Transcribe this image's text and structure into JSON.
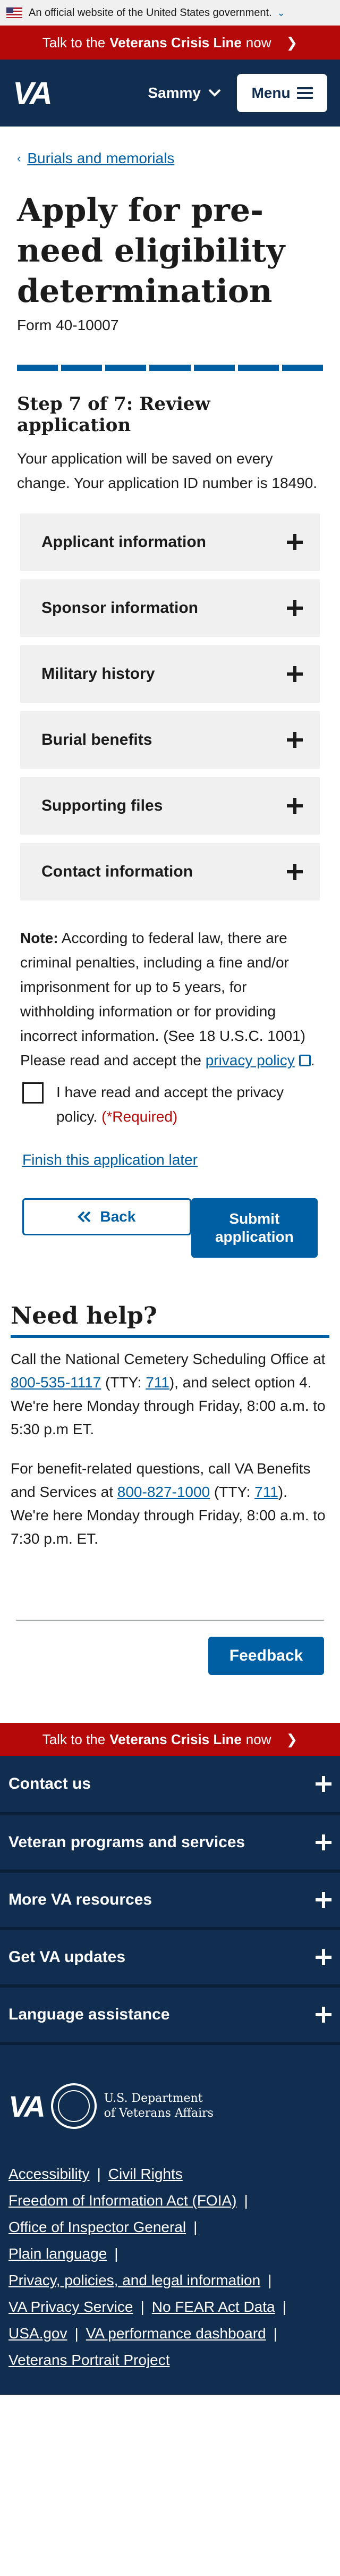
{
  "gov_banner": {
    "text": "An official website of the United States government."
  },
  "crisis_line": {
    "prefix": "Talk to the",
    "bold": "Veterans Crisis Line",
    "suffix": "now"
  },
  "header": {
    "logo": "VA",
    "user_name": "Sammy",
    "menu_label": "Menu"
  },
  "breadcrumb": {
    "label": "Burials and memorials"
  },
  "page": {
    "title": "Apply for pre-need eligibility determination",
    "form_number": "Form 40-10007",
    "progress_segments": 7,
    "progress_completed": 7,
    "step_title": "Step 7 of 7: Review application",
    "save_note": "Your application will be saved on every change. Your application ID number is 18490."
  },
  "sections": [
    "Applicant information",
    "Sponsor information",
    "Military history",
    "Burial benefits",
    "Supporting files",
    "Contact information"
  ],
  "legal": {
    "note_label": "Note:",
    "note_text": " According to federal law, there are criminal penalties, including a fine and/or imprisonment for up to 5 years, for withholding information or for providing incorrect information. (See 18 U.S.C. 1001)",
    "accept_prefix": "Please read and accept the ",
    "privacy_link": "privacy policy",
    "accept_suffix": "."
  },
  "privacy_checkbox": {
    "label": "I have read and accept the privacy policy.",
    "required": "(*Required)",
    "checked": false
  },
  "finish_later": "Finish this application later",
  "buttons": {
    "back": "Back",
    "submit": "Submit application"
  },
  "help": {
    "title": "Need help?",
    "p1_a": "Call the National Cemetery Scheduling Office at ",
    "p1_phone": "800-535-1117",
    "p1_b": " (TTY: ",
    "p1_tty": "711",
    "p1_c": "), and select option 4. We're here Monday through Friday, 8:00 a.m. to 5:30 p.m ET.",
    "p2_a": "For benefit-related questions, call VA Benefits and Services at ",
    "p2_phone": "800-827-1000",
    "p2_b": " (TTY: ",
    "p2_tty": "711",
    "p2_c": "). We're here Monday through Friday, 8:00 a.m. to 7:30 p.m. ET."
  },
  "feedback": "Feedback",
  "footer": {
    "sections": [
      "Contact us",
      "Veteran programs and services",
      "More VA resources",
      "Get VA updates",
      "Language assistance"
    ],
    "logo": "VA",
    "dept_line1": "U.S. Department",
    "dept_line2": "of Veterans Affairs",
    "links": {
      "accessibility": "Accessibility",
      "civil_rights": "Civil Rights",
      "foia": "Freedom of Information Act (FOIA)",
      "oig": "Office of Inspector General",
      "plain_language": "Plain language",
      "privacy_policies": "Privacy, policies, and legal information",
      "va_privacy": "VA Privacy Service",
      "no_fear": "No FEAR Act Data",
      "usagov": "USA.gov",
      "performance": "VA performance dashboard",
      "portrait": "Veterans Portrait Project"
    }
  }
}
